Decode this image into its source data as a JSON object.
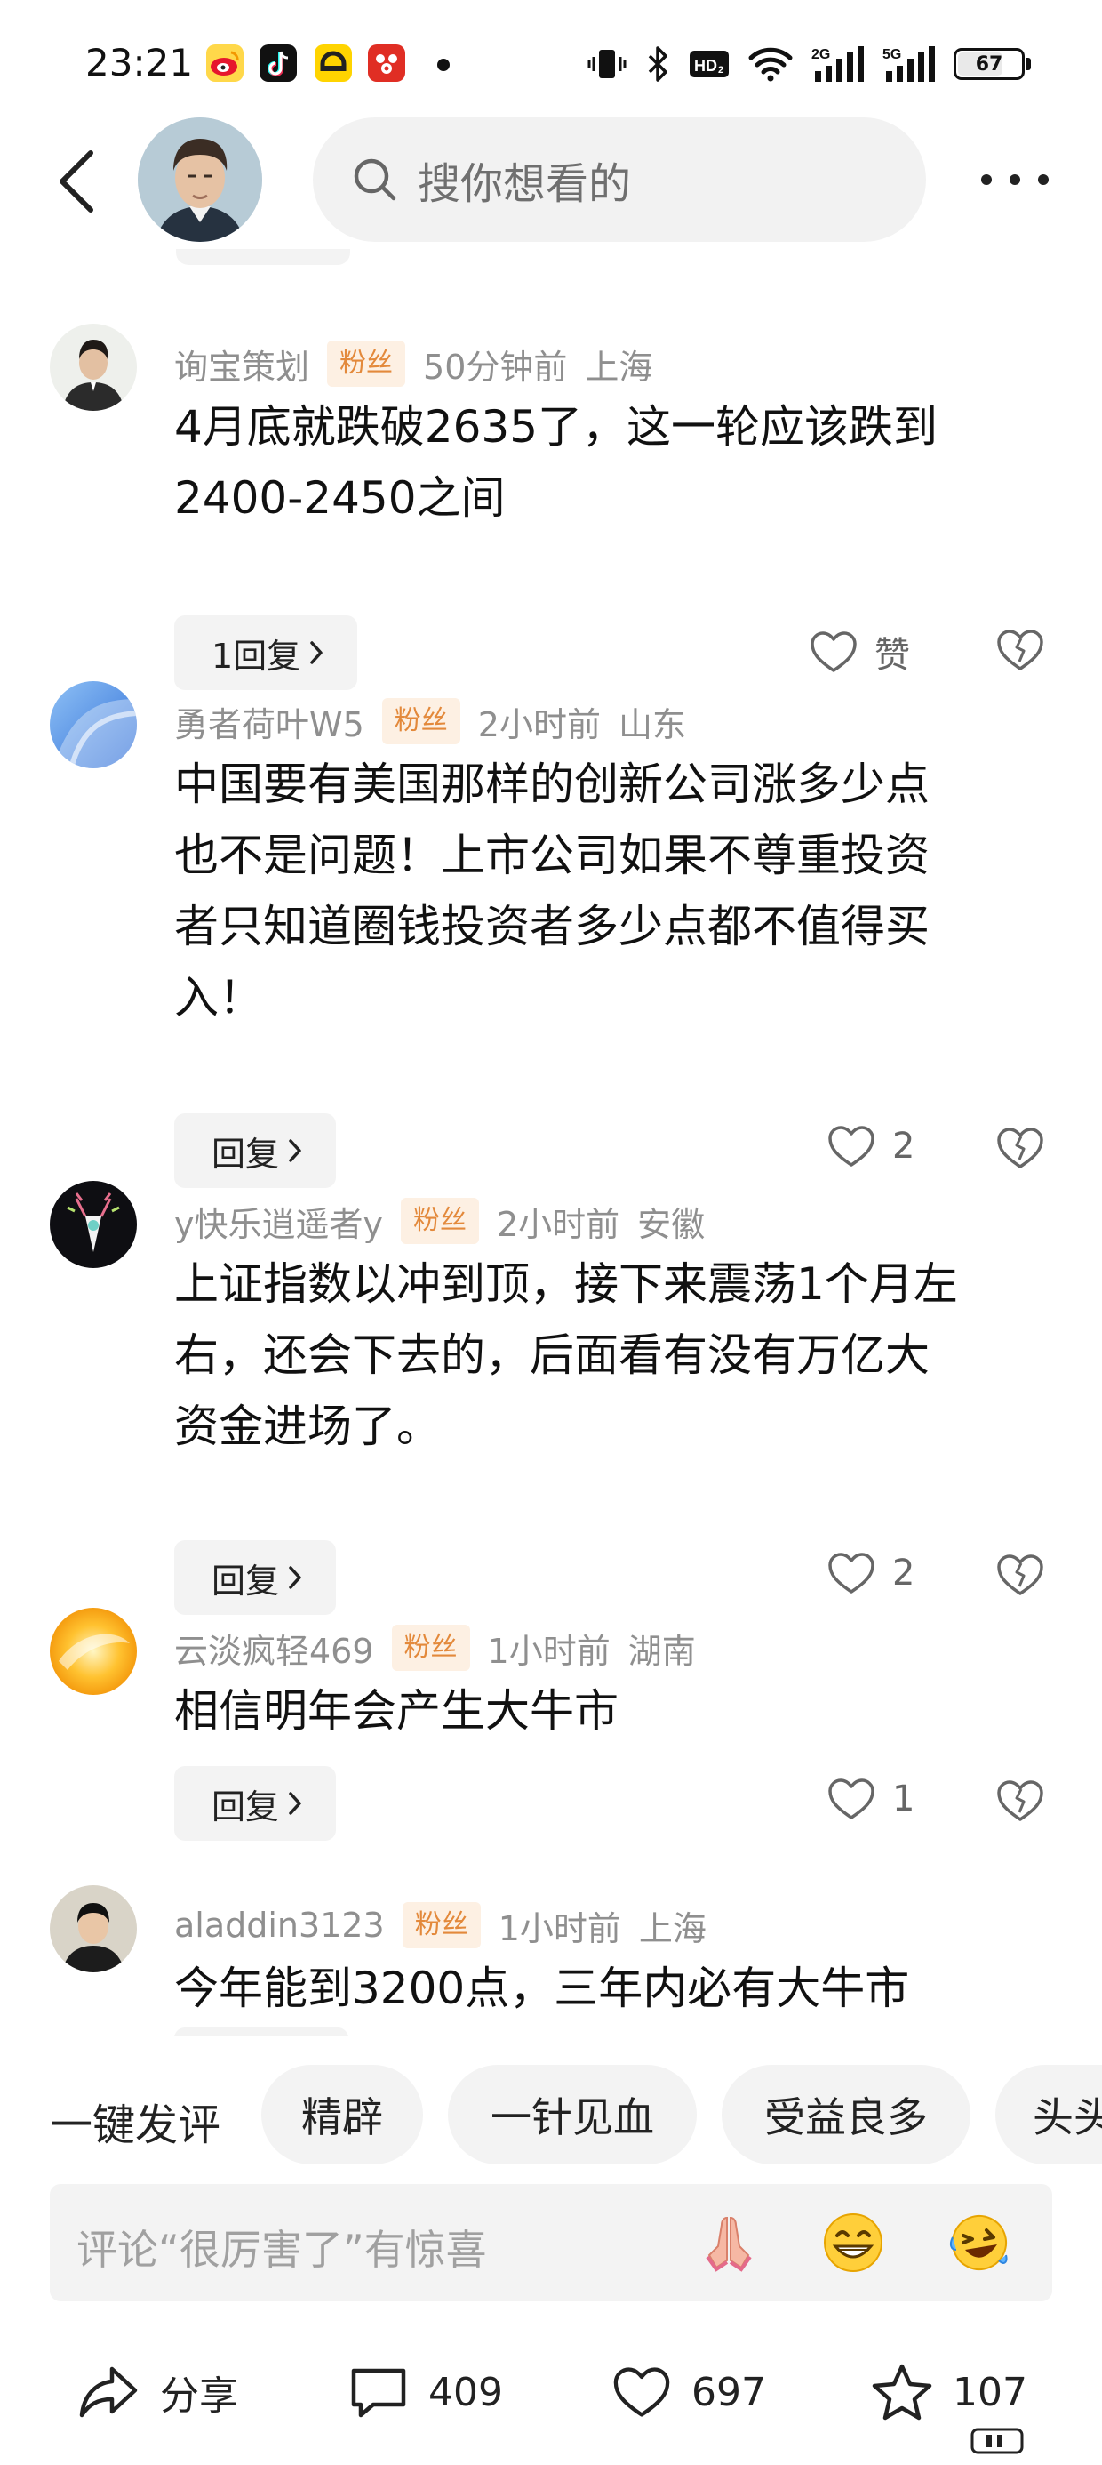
{
  "status_bar": {
    "time": "23:21",
    "apps": [
      "weibo-icon",
      "tiktok-icon",
      "app-icon",
      "pinduoduo-icon"
    ],
    "network_hd": "HD2",
    "signal_1_label": "2G",
    "signal_2_label": "5G",
    "battery_level": "67"
  },
  "header": {
    "search_placeholder": "搜你想看的"
  },
  "comments": [
    {
      "username": "询宝策划",
      "badge": "粉丝",
      "time": "50分钟前",
      "location": "上海",
      "text_lines": [
        "4月底就跌破2635了，这一轮应该跌到",
        "2400-2450之间"
      ],
      "reply_label": "1回复",
      "like_label": "赞"
    },
    {
      "username": "勇者荷叶W5",
      "badge": "粉丝",
      "time": "2小时前",
      "location": "山东",
      "text_lines": [
        "中国要有美国那样的创新公司涨多少点",
        "也不是问题！上市公司如果不尊重投资",
        "者只知道圈钱投资者多少点都不值得买",
        "入！"
      ],
      "reply_label": "回复",
      "like_label": "2"
    },
    {
      "username": "y快乐逍遥者y",
      "badge": "粉丝",
      "time": "2小时前",
      "location": "安徽",
      "text_lines": [
        "上证指数以冲到顶，接下来震荡1个月左",
        "右，还会下去的，后面看有没有万亿大",
        "资金进场了。"
      ],
      "reply_label": "回复",
      "like_label": "2"
    },
    {
      "username": "云淡疯轻469",
      "badge": "粉丝",
      "time": "1小时前",
      "location": "湖南",
      "text_lines": [
        "相信明年会产生大牛市"
      ],
      "reply_label": "回复",
      "like_label": "1"
    },
    {
      "username": "aladdin3123",
      "badge": "粉丝",
      "time": "1小时前",
      "location": "上海",
      "text_lines": [
        "今年能到3200点，三年内必有大牛市"
      ]
    }
  ],
  "quick_comment": {
    "label": "一键发评",
    "chips": [
      "精辟",
      "一针见血",
      "受益良多",
      "头头"
    ]
  },
  "input": {
    "placeholder": "评论“很厉害了”有惊喜",
    "emojis": [
      "folded-hands-emoji",
      "grinning-emoji",
      "laughing-tears-emoji"
    ]
  },
  "bottom_bar": {
    "share_label": "分享",
    "comment_count": "409",
    "like_count": "697",
    "favorite_count": "107"
  },
  "colors": {
    "badge_bg": "#fdf0e3",
    "badge_text": "#e3893b",
    "meta_text": "#8f8f8f",
    "pill_bg": "#f3f3f3"
  }
}
